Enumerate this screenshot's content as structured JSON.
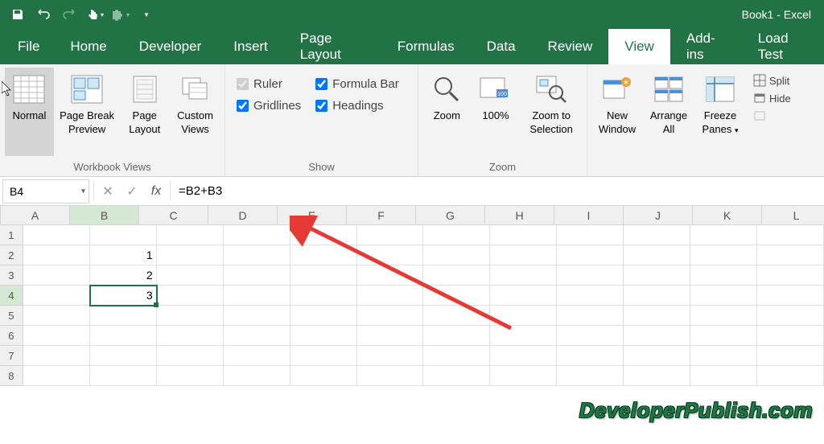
{
  "title": "Book1 - Excel",
  "tabs": {
    "file": "File",
    "home": "Home",
    "developer": "Developer",
    "insert": "Insert",
    "pagelayout": "Page Layout",
    "formulas": "Formulas",
    "data": "Data",
    "review": "Review",
    "view": "View",
    "addins": "Add-ins",
    "loadtest": "Load Test"
  },
  "ribbon": {
    "views_group": "Workbook Views",
    "show_group": "Show",
    "zoom_group": "Zoom",
    "normal": "Normal",
    "pagebreak": "Page Break Preview",
    "pagelayout": "Page Layout",
    "custom": "Custom Views",
    "ruler": "Ruler",
    "gridlines": "Gridlines",
    "formulabar": "Formula Bar",
    "headings": "Headings",
    "zoom": "Zoom",
    "hundred": "100%",
    "zoomsel": "Zoom to Selection",
    "newwin": "New Window",
    "arrange": "Arrange All",
    "freeze": "Freeze Panes",
    "split": "Split",
    "hide": "Hide"
  },
  "namebox": "B4",
  "formula": "=B2+B3",
  "columns": [
    "A",
    "B",
    "C",
    "D",
    "E",
    "F",
    "G",
    "H",
    "I",
    "J",
    "K",
    "L"
  ],
  "rows": [
    {
      "n": "1",
      "cells": [
        "",
        "",
        "",
        "",
        "",
        "",
        "",
        "",
        "",
        "",
        "",
        ""
      ]
    },
    {
      "n": "2",
      "cells": [
        "",
        "1",
        "",
        "",
        "",
        "",
        "",
        "",
        "",
        "",
        "",
        ""
      ]
    },
    {
      "n": "3",
      "cells": [
        "",
        "2",
        "",
        "",
        "",
        "",
        "",
        "",
        "",
        "",
        "",
        ""
      ]
    },
    {
      "n": "4",
      "cells": [
        "",
        "3",
        "",
        "",
        "",
        "",
        "",
        "",
        "",
        "",
        "",
        ""
      ]
    },
    {
      "n": "5",
      "cells": [
        "",
        "",
        "",
        "",
        "",
        "",
        "",
        "",
        "",
        "",
        "",
        ""
      ]
    },
    {
      "n": "6",
      "cells": [
        "",
        "",
        "",
        "",
        "",
        "",
        "",
        "",
        "",
        "",
        "",
        ""
      ]
    },
    {
      "n": "7",
      "cells": [
        "",
        "",
        "",
        "",
        "",
        "",
        "",
        "",
        "",
        "",
        "",
        ""
      ]
    },
    {
      "n": "8",
      "cells": [
        "",
        "",
        "",
        "",
        "",
        "",
        "",
        "",
        "",
        "",
        "",
        ""
      ]
    }
  ],
  "selected": {
    "row": 3,
    "col": 1
  },
  "watermark": "DeveloperPublish.com"
}
